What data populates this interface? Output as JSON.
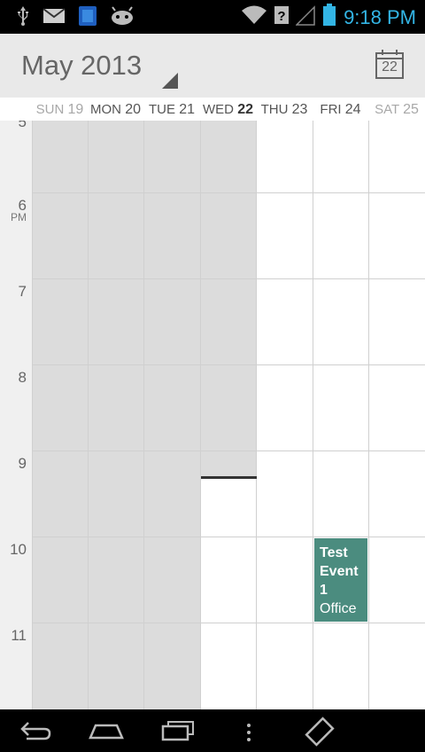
{
  "status_bar": {
    "time": "9:18 PM",
    "icons": [
      "usb-icon",
      "mail-icon",
      "app-icon",
      "android-icon",
      "wifi-icon",
      "signal-icon",
      "battery-icon"
    ],
    "time_color": "#33b5e5"
  },
  "action_bar": {
    "title": "May 2013",
    "today_day": "22"
  },
  "week_header": {
    "days": [
      {
        "dow": "SUN",
        "num": "19",
        "state": "past"
      },
      {
        "dow": "MON",
        "num": "20",
        "state": "past"
      },
      {
        "dow": "TUE",
        "num": "21",
        "state": "past"
      },
      {
        "dow": "WED",
        "num": "22",
        "state": "today"
      },
      {
        "dow": "THU",
        "num": "23",
        "state": "future"
      },
      {
        "dow": "FRI",
        "num": "24",
        "state": "future"
      },
      {
        "dow": "SAT",
        "num": "25",
        "state": "weekend"
      }
    ]
  },
  "hours": [
    {
      "label": "5"
    },
    {
      "label": "6",
      "ampm": "PM"
    },
    {
      "label": "7"
    },
    {
      "label": "8"
    },
    {
      "label": "9"
    },
    {
      "label": "10"
    },
    {
      "label": "11"
    }
  ],
  "event": {
    "title_line1": "Test",
    "title_line2": "Event",
    "title_line3": "1",
    "location": "Office",
    "color": "#4b8c7f"
  },
  "colors": {
    "past_shade": "#dcdcdc",
    "accent": "#33b5e5"
  }
}
